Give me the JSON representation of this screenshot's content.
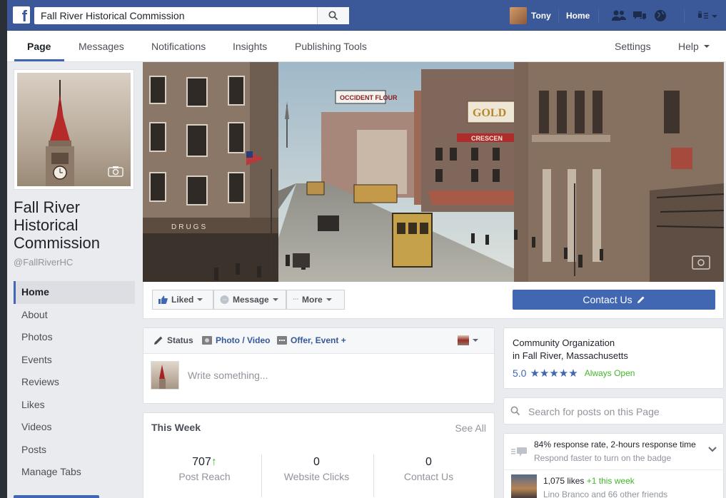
{
  "topbar": {
    "logo": "f",
    "search_value": "Fall River Historical Commission",
    "user_name": "Tony",
    "home_label": "Home",
    "icons": [
      "search-icon",
      "friend-requests-icon",
      "messages-icon",
      "notifications-globe-icon",
      "account-menu-icon"
    ]
  },
  "page_nav": {
    "items": [
      "Page",
      "Messages",
      "Notifications",
      "Insights",
      "Publishing Tools"
    ],
    "settings": "Settings",
    "help": "Help"
  },
  "page": {
    "name_lines": [
      "Fall River",
      "Historical",
      "Commission"
    ],
    "handle": "@FallRiverHC"
  },
  "side_nav": [
    "Home",
    "About",
    "Photos",
    "Events",
    "Reviews",
    "Likes",
    "Videos",
    "Posts",
    "Manage Tabs"
  ],
  "cover_actions": {
    "liked": "Liked",
    "message": "Message",
    "more": "More",
    "contact": "Contact Us"
  },
  "cover_signs": {
    "top_billboard": "OCCIDENT FLOUR",
    "gold": "GOLD",
    "crescent": "CRESCEN",
    "drugs": "DRUGS"
  },
  "composer": {
    "tab_status": "Status",
    "tab_photo": "Photo / Video",
    "tab_offer": "Offer, Event +",
    "placeholder": "Write something..."
  },
  "this_week": {
    "title": "This Week",
    "see_all": "See All",
    "stats": [
      {
        "value": "707",
        "label": "Post Reach",
        "trend": "up"
      },
      {
        "value": "0",
        "label": "Website Clicks"
      },
      {
        "value": "0",
        "label": "Contact Us"
      }
    ]
  },
  "about": {
    "line1": "Community Organization",
    "line2": "in Fall River, Massachusetts",
    "rating": "5.0",
    "stars": "★★★★★",
    "hours": "Always Open"
  },
  "post_search": {
    "placeholder": "Search for posts on this Page"
  },
  "response": {
    "line1": "84% response rate, 2-hours response time",
    "line2": "Respond faster to turn on the badge"
  },
  "likes": {
    "count_text": "1,075 likes",
    "week_text": "+1 this week",
    "friends_text": "Lino Branco and 66 other friends"
  },
  "colors": {
    "brand_blue": "#3b5998",
    "button_blue": "#4267b2",
    "green": "#42b72a"
  }
}
